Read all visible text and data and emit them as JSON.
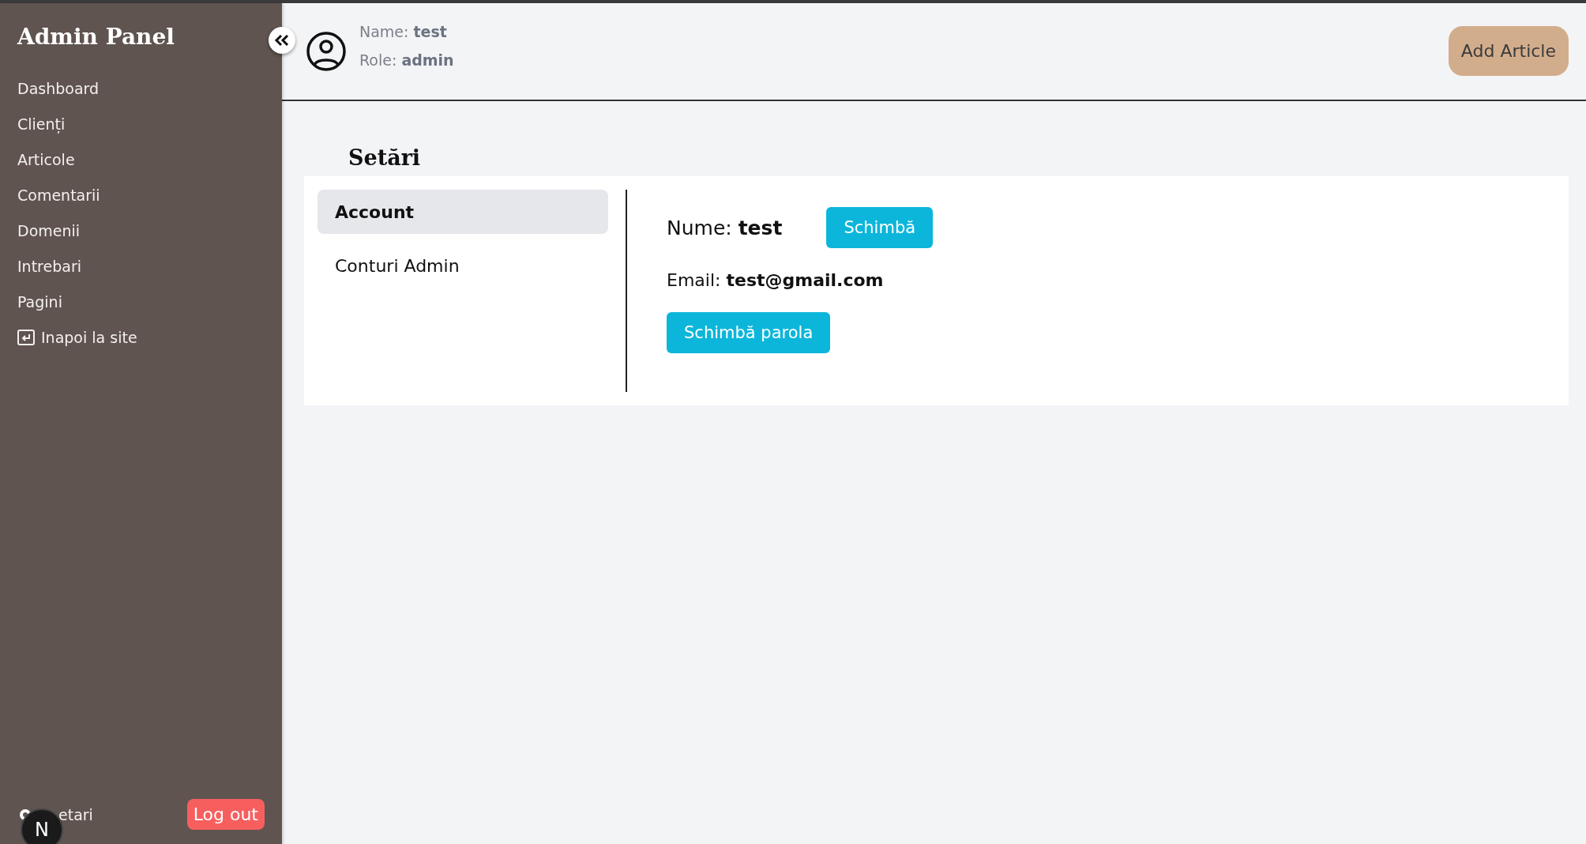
{
  "sidebar": {
    "title": "Admin Panel",
    "items": [
      {
        "label": "Dashboard",
        "kind": "link"
      },
      {
        "label": "Clienți",
        "kind": "link"
      },
      {
        "label": "Articole",
        "kind": "link"
      },
      {
        "label": "Comentarii",
        "kind": "link"
      },
      {
        "label": "Domenii",
        "kind": "link"
      },
      {
        "label": "Intrebari",
        "kind": "link"
      },
      {
        "label": "Pagini",
        "kind": "link"
      },
      {
        "label": "Inapoi la site",
        "kind": "back"
      }
    ],
    "footer": {
      "settings_label": "etari",
      "logout": "Log out",
      "badge": "N"
    }
  },
  "header": {
    "name_label": "Name:",
    "name": "test",
    "role_label": "Role:",
    "role": "admin",
    "add_button": "Add Article"
  },
  "page": {
    "title": "Setări",
    "tabs": [
      {
        "label": "Account",
        "selected": true
      },
      {
        "label": "Conturi Admin",
        "selected": false
      }
    ],
    "account": {
      "name_label": "Nume:",
      "name": "test",
      "change_button": "Schimbă",
      "email_label": "Email:",
      "email": "test@gmail.com",
      "password_button": "Schimbă parola"
    }
  }
}
